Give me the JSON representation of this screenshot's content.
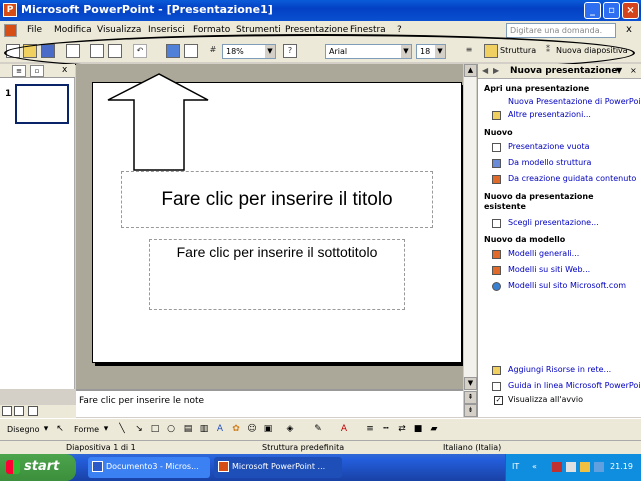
{
  "window": {
    "app_icon": "powerpoint-icon",
    "title": "Microsoft PowerPoint - [Presentazione1]",
    "buttons": [
      "minimize-icon",
      "restore-icon",
      "close-icon"
    ]
  },
  "menubar": {
    "items": [
      "File",
      "Modifica",
      "Visualizza",
      "Inserisci",
      "Formato",
      "Strumenti",
      "Presentazione",
      "Finestra",
      "?"
    ],
    "help_placeholder": "Digitare una domanda.",
    "close": "x"
  },
  "toolbar": {
    "zoom": "18%",
    "font": "Arial",
    "size": "18",
    "design_label": "Struttura",
    "new_slide_label": "Nuova diapositiva",
    "help_icon": "?"
  },
  "outline": {
    "slide_number": "1",
    "close": "x"
  },
  "slide": {
    "title_placeholder": "Fare clic per inserire il titolo",
    "subtitle_placeholder": "Fare clic per inserire il sottotitolo"
  },
  "notes": {
    "placeholder": "Fare clic per inserire le note"
  },
  "taskpane": {
    "title": "Nuova presentazione",
    "sections": {
      "open": "Apri una presentazione",
      "new": "Nuovo",
      "from_existing": "Nuovo da presentazione esistente",
      "from_template": "Nuovo da modello"
    },
    "links": {
      "new_presentation": "Nuova Presentazione di PowerPoint",
      "other_presentations": "Altre presentazioni...",
      "blank": "Presentazione vuota",
      "from_design": "Da modello struttura",
      "autocontent": "Da creazione guidata contenuto",
      "choose_presentation": "Scegli presentazione...",
      "general_templates": "Modelli generali...",
      "web_templates": "Modelli su siti Web...",
      "ms_templates": "Modelli sul sito Microsoft.com",
      "add_network": "Aggiungi Risorse in rete...",
      "online_help": "Guida in linea Microsoft PowerPoint",
      "show_startup": "Visualizza all'avvio"
    }
  },
  "drawbar": {
    "draw_label": "Disegno",
    "shapes_label": "Forme"
  },
  "statusbar": {
    "slide": "Diapositiva 1 di 1",
    "design": "Struttura predefinita",
    "language": "Italiano (Italia)"
  },
  "taskbar": {
    "start": "start",
    "buttons": [
      "Documento3 - Micros...",
      "Microsoft PowerPoint ..."
    ],
    "lang": "IT",
    "clock": "21.19"
  },
  "colors": {
    "title_bar": "#0a5cd8",
    "taskbar": "#245edb",
    "start_green": "#3c8f3c",
    "tray": "#0f8ddf",
    "link_blue": "#0000c0",
    "slide_area": "#aca899"
  }
}
